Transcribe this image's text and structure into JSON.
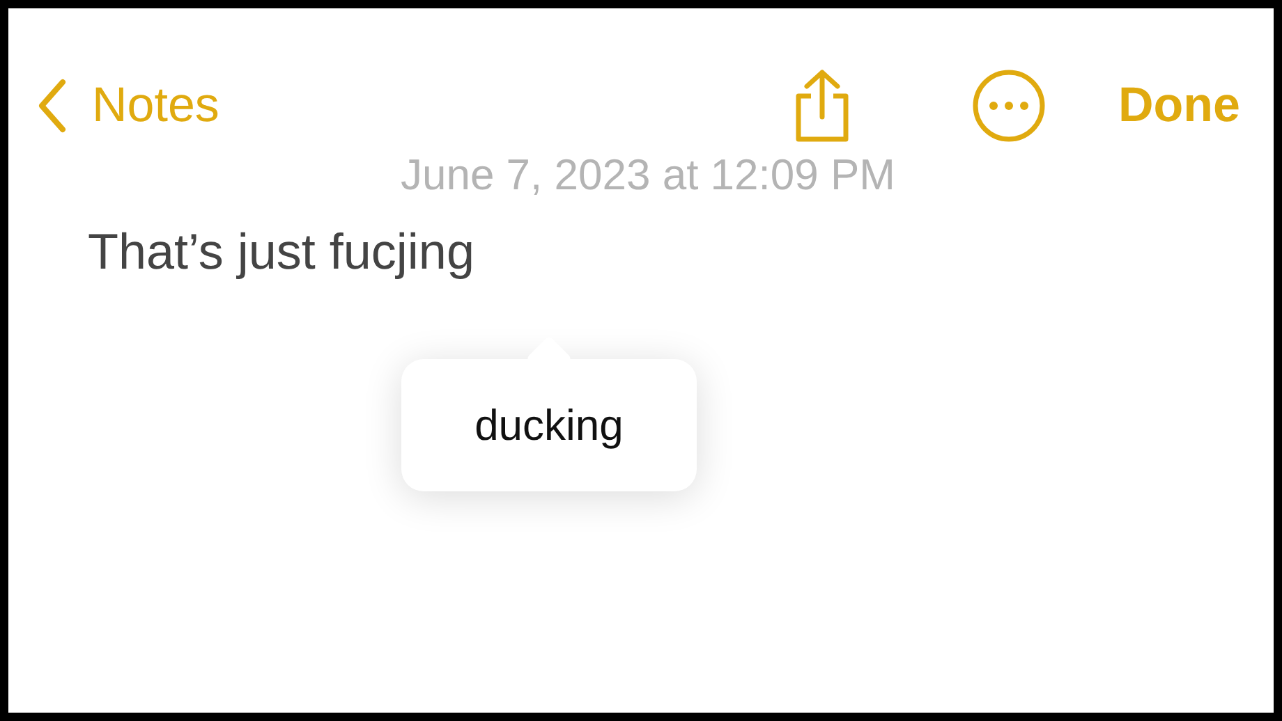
{
  "nav": {
    "back_label": "Notes",
    "done_label": "Done"
  },
  "date": "June 7, 2023 at 12:09 PM",
  "note": {
    "text": "That’s just fucjing"
  },
  "autocorrect": {
    "suggestion": "ducking"
  }
}
